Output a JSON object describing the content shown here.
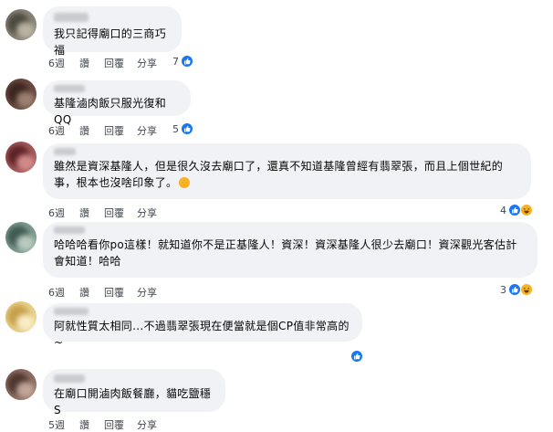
{
  "comments": [
    {
      "text": "我只記得廟口的三商巧福",
      "week": "6週",
      "like": "讚",
      "reply": "回覆",
      "share": "分享",
      "count": "7",
      "reactions": [
        "like"
      ]
    },
    {
      "text": "基隆滷肉飯只服光復和QQ",
      "week": "6週",
      "like": "讚",
      "reply": "回覆",
      "share": "分享",
      "count": "5",
      "reactions": [
        "like"
      ]
    },
    {
      "text_line1": "雖然是資深基隆人，但是很久沒去廟口了，還真不知道基隆曾經有翡翠張，而且上個世紀的",
      "text_line2": "事，根本也沒啥印象了。",
      "week": "6週",
      "like": "讚",
      "reply": "回覆",
      "share": "分享",
      "count": "4",
      "reactions": [
        "like",
        "haha"
      ]
    },
    {
      "text_line1": "哈哈哈看你po這樣！就知道你不是正基隆人！資深！資深基隆人很少去廟口！資深觀光客估計",
      "text_line2": "會知道！哈哈",
      "week": "6週",
      "like": "讚",
      "reply": "回覆",
      "share": "分享",
      "count": "3",
      "reactions": [
        "like",
        "haha"
      ]
    },
    {
      "text": "阿就性質太相同...不過翡翠張現在便當就是個CP值非常高的~",
      "week": "6週",
      "like": "讚",
      "reply": "回覆",
      "share": "分享",
      "count": "",
      "reactions": [
        "like"
      ]
    },
    {
      "text": "在廟口開滷肉飯餐廳，貓吃鹽穩S",
      "week": "5週",
      "like": "讚",
      "reply": "回覆",
      "share": "分享",
      "count": "",
      "reactions": []
    }
  ],
  "colors": {
    "bubble": "#f0f2f5",
    "like_blue": "#1877f2",
    "haha_yellow": "#f7b125",
    "meta_gray": "#65676b"
  }
}
